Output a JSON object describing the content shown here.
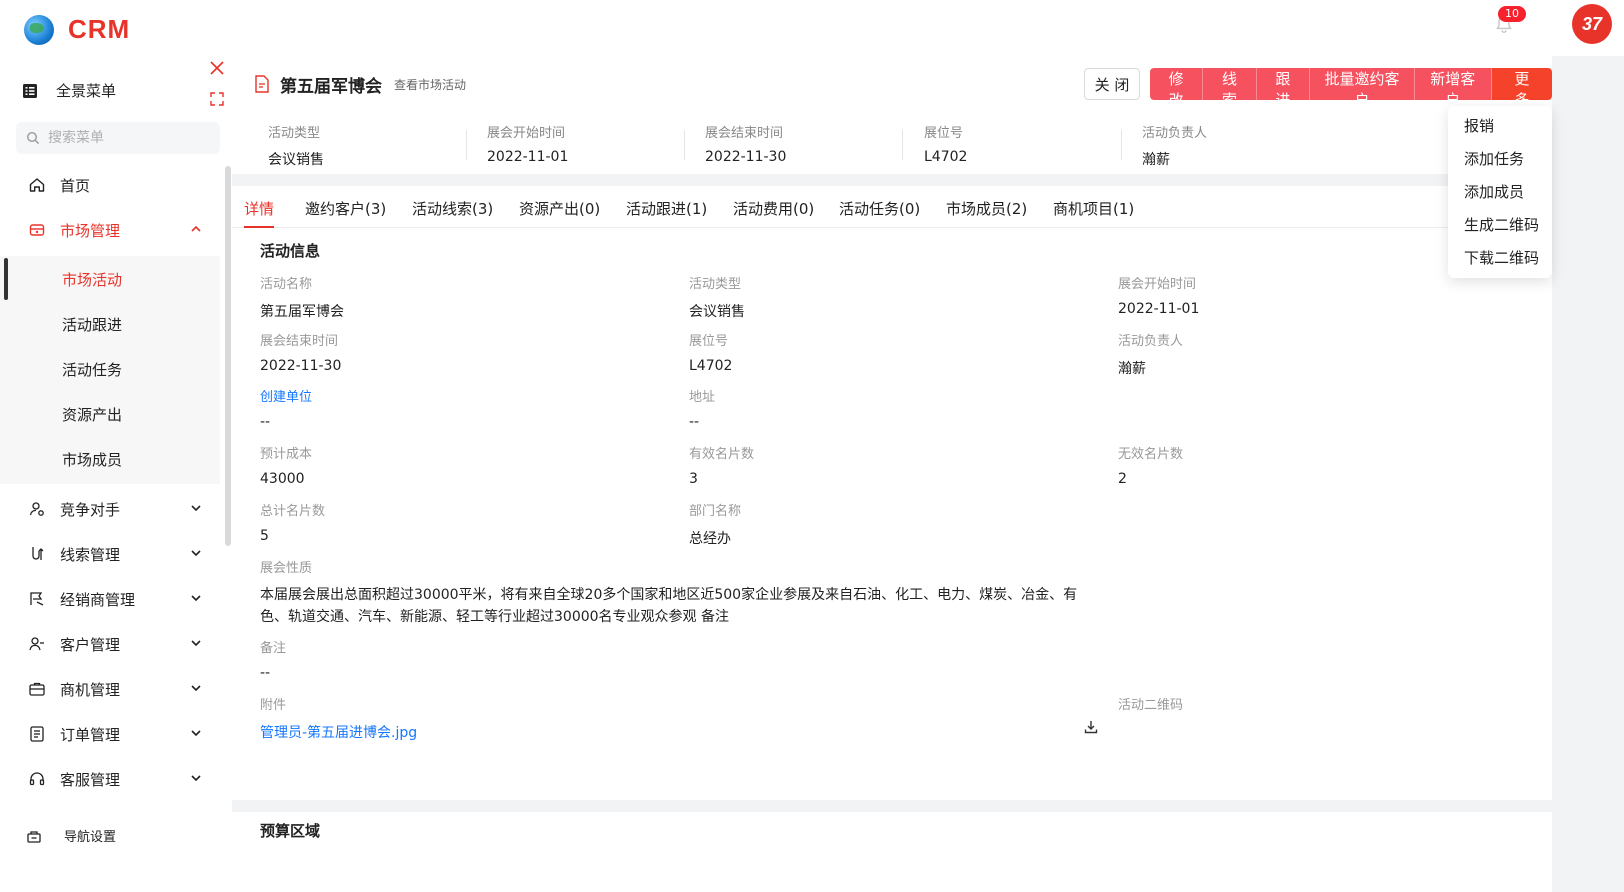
{
  "app": {
    "logo_text": "CRM",
    "notification_count": "10",
    "avatar_text": "37"
  },
  "sidebar": {
    "menu_all": "全景菜单",
    "search_placeholder": "搜索菜单",
    "items": [
      {
        "label": "首页"
      },
      {
        "label": "市场管理"
      },
      {
        "label": "竞争对手"
      },
      {
        "label": "线索管理"
      },
      {
        "label": "经销商管理"
      },
      {
        "label": "客户管理"
      },
      {
        "label": "商机管理"
      },
      {
        "label": "订单管理"
      },
      {
        "label": "客服管理"
      }
    ],
    "sub_items": [
      {
        "label": "市场活动"
      },
      {
        "label": "活动跟进"
      },
      {
        "label": "活动任务"
      },
      {
        "label": "资源产出"
      },
      {
        "label": "市场成员"
      }
    ],
    "nav_settings": "导航设置"
  },
  "panel": {
    "title": "第五届军博会",
    "subtitle": "查看市场活动",
    "close_label": "关 闭",
    "actions": [
      "修 改",
      "线 索",
      "跟 进",
      "批量邀约客户",
      "新增客户",
      "更 多"
    ],
    "more_menu": [
      "报销",
      "添加任务",
      "添加成员",
      "生成二维码",
      "下载二维码"
    ]
  },
  "summary": [
    {
      "key": "活动类型",
      "value": "会议销售"
    },
    {
      "key": "展会开始时间",
      "value": "2022-11-01"
    },
    {
      "key": "展会结束时间",
      "value": "2022-11-30"
    },
    {
      "key": "展位号",
      "value": "L4702"
    },
    {
      "key": "活动负责人",
      "value": "瀚薪"
    }
  ],
  "tabs": [
    "详情",
    "邀约客户(3)",
    "活动线索(3)",
    "资源产出(0)",
    "活动跟进(1)",
    "活动费用(0)",
    "活动任务(0)",
    "市场成员(2)",
    "商机项目(1)"
  ],
  "detail": {
    "section_title": "活动信息",
    "fields": {
      "name_k": "活动名称",
      "name_v": "第五届军博会",
      "type_k": "活动类型",
      "type_v": "会议销售",
      "start_k": "展会开始时间",
      "start_v": "2022-11-01",
      "end_k": "展会结束时间",
      "end_v": "2022-11-30",
      "booth_k": "展位号",
      "booth_v": "L4702",
      "owner_k": "活动负责人",
      "owner_v": "瀚薪",
      "org_k": "创建单位",
      "org_v": "--",
      "addr_k": "地址",
      "addr_v": "--",
      "cost_k": "预计成本",
      "cost_v": "43000",
      "valid_k": "有效名片数",
      "valid_v": "3",
      "invalid_k": "无效名片数",
      "invalid_v": "2",
      "total_k": "总计名片数",
      "total_v": "5",
      "dept_k": "部门名称",
      "dept_v": "总经办",
      "nature_k": "展会性质",
      "nature_v": "本届展会展出总面积超过30000平米，将有来自全球20多个国家和地区近500家企业参展及来自石油、化工、电力、煤炭、冶金、有色、轨道交通、汽车、新能源、轻工等行业超过30000名专业观众参观 备注",
      "remark_k": "备注",
      "remark_v": "--",
      "attach_k": "附件",
      "attach_v": "管理员-第五届进博会.jpg",
      "qr_k": "活动二维码"
    },
    "budget_title": "预算区域"
  }
}
